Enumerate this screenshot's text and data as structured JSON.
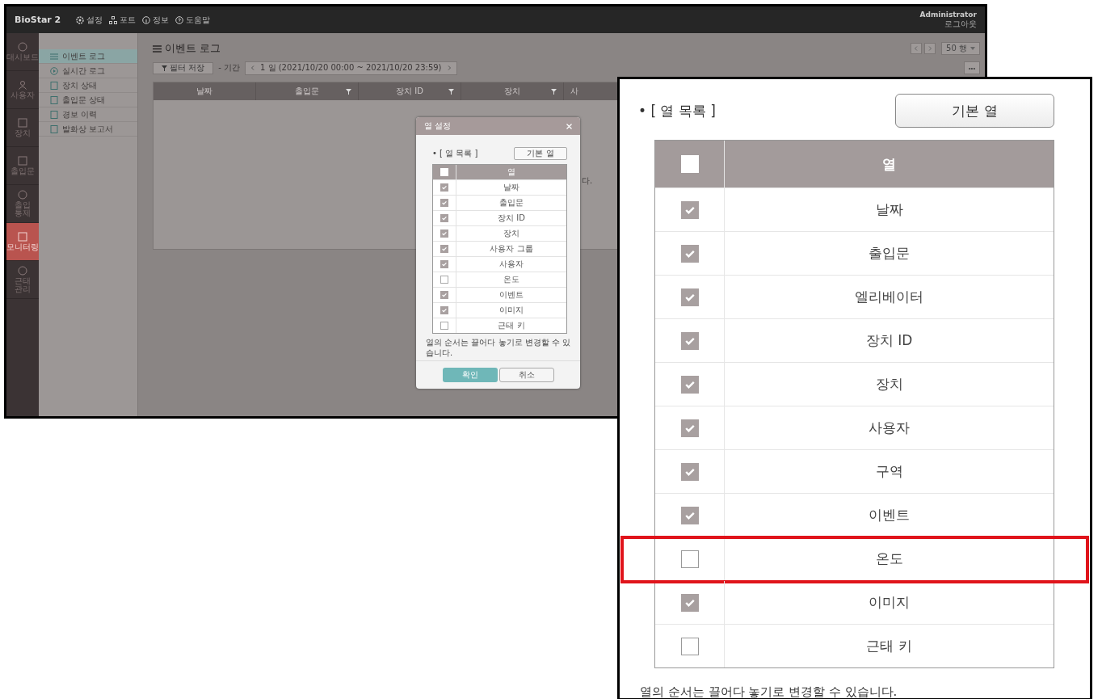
{
  "app": {
    "logo": "BioStar 2",
    "nav": [
      {
        "kind": "gear",
        "label": "설정"
      },
      {
        "kind": "network",
        "label": "포트"
      },
      {
        "kind": "info",
        "label": "정보"
      },
      {
        "kind": "help",
        "label": "도움말"
      }
    ],
    "user": "Administrator",
    "logout": "로그아웃"
  },
  "rail": [
    {
      "kind": "dashboard",
      "label": "대시보드",
      "selected": false
    },
    {
      "kind": "user",
      "label": "사용자",
      "selected": false
    },
    {
      "kind": "device",
      "label": "장치",
      "selected": false
    },
    {
      "kind": "door",
      "label": "출입문",
      "selected": false
    },
    {
      "kind": "access",
      "label": "출입 통제",
      "selected": false
    },
    {
      "kind": "monitor",
      "label": "모니터링",
      "selected": true
    },
    {
      "kind": "clock",
      "label": "근태 관리",
      "selected": false
    }
  ],
  "submenu": [
    {
      "kind": "list",
      "label": "이벤트 로그",
      "selected": true
    },
    {
      "kind": "play",
      "label": "실시간 로그",
      "selected": false
    },
    {
      "kind": "device",
      "label": "장치 상태",
      "selected": false
    },
    {
      "kind": "door",
      "label": "출입문 상태",
      "selected": false
    },
    {
      "kind": "alarm",
      "label": "경보 이력",
      "selected": false
    },
    {
      "kind": "report",
      "label": "발화상 보고서",
      "selected": false
    }
  ],
  "page": {
    "title": "이벤트 로그",
    "filter_save": "필터 저장",
    "period_label": "- 기간",
    "period": "1 일 (2021/10/20 00:00 ~ 2021/10/20 23:59)",
    "rows_per_page": "50 행",
    "more": "•••"
  },
  "table": {
    "columns": [
      {
        "label": "날짜",
        "filter": false
      },
      {
        "label": "출입문",
        "filter": true
      },
      {
        "label": "장치 ID",
        "filter": true
      },
      {
        "label": "장치",
        "filter": true
      },
      {
        "label": "사",
        "filter": false
      }
    ],
    "empty_message": "다."
  },
  "dialog": {
    "title": "열 설정",
    "list_label": "• [ 열 목록 ]",
    "default_button": "기본 열",
    "header": "열",
    "select_all_checked": false,
    "rows": [
      {
        "label": "날짜",
        "checked": true
      },
      {
        "label": "출입문",
        "checked": true
      },
      {
        "label": "장치 ID",
        "checked": true
      },
      {
        "label": "장치",
        "checked": true
      },
      {
        "label": "사용자 그룹",
        "checked": true
      },
      {
        "label": "사용자",
        "checked": true
      },
      {
        "label": "온도",
        "checked": false
      },
      {
        "label": "이벤트",
        "checked": true
      },
      {
        "label": "이미지",
        "checked": true
      },
      {
        "label": "근태 키",
        "checked": false
      }
    ],
    "note": "열의 순서는 끌어다 놓기로 변경할 수 있습니다.",
    "ok": "확인",
    "cancel": "취소"
  },
  "callout": {
    "list_label": "• [ 열 목록 ]",
    "default_button": "기본 열",
    "header": "열",
    "select_all_checked": false,
    "rows": [
      {
        "label": "날짜",
        "checked": true,
        "highlighted": false
      },
      {
        "label": "출입문",
        "checked": true,
        "highlighted": false
      },
      {
        "label": "엘리베이터",
        "checked": true,
        "highlighted": false
      },
      {
        "label": "장치 ID",
        "checked": true,
        "highlighted": false
      },
      {
        "label": "장치",
        "checked": true,
        "highlighted": false
      },
      {
        "label": "사용자",
        "checked": true,
        "highlighted": false
      },
      {
        "label": "구역",
        "checked": true,
        "highlighted": false
      },
      {
        "label": "이벤트",
        "checked": true,
        "highlighted": false
      },
      {
        "label": "온도",
        "checked": false,
        "highlighted": true
      },
      {
        "label": "이미지",
        "checked": true,
        "highlighted": false
      },
      {
        "label": "근태 키",
        "checked": false,
        "highlighted": false
      }
    ],
    "note": "열의 순서는 끌어다 놓기로 변경할 수 있습니다."
  }
}
